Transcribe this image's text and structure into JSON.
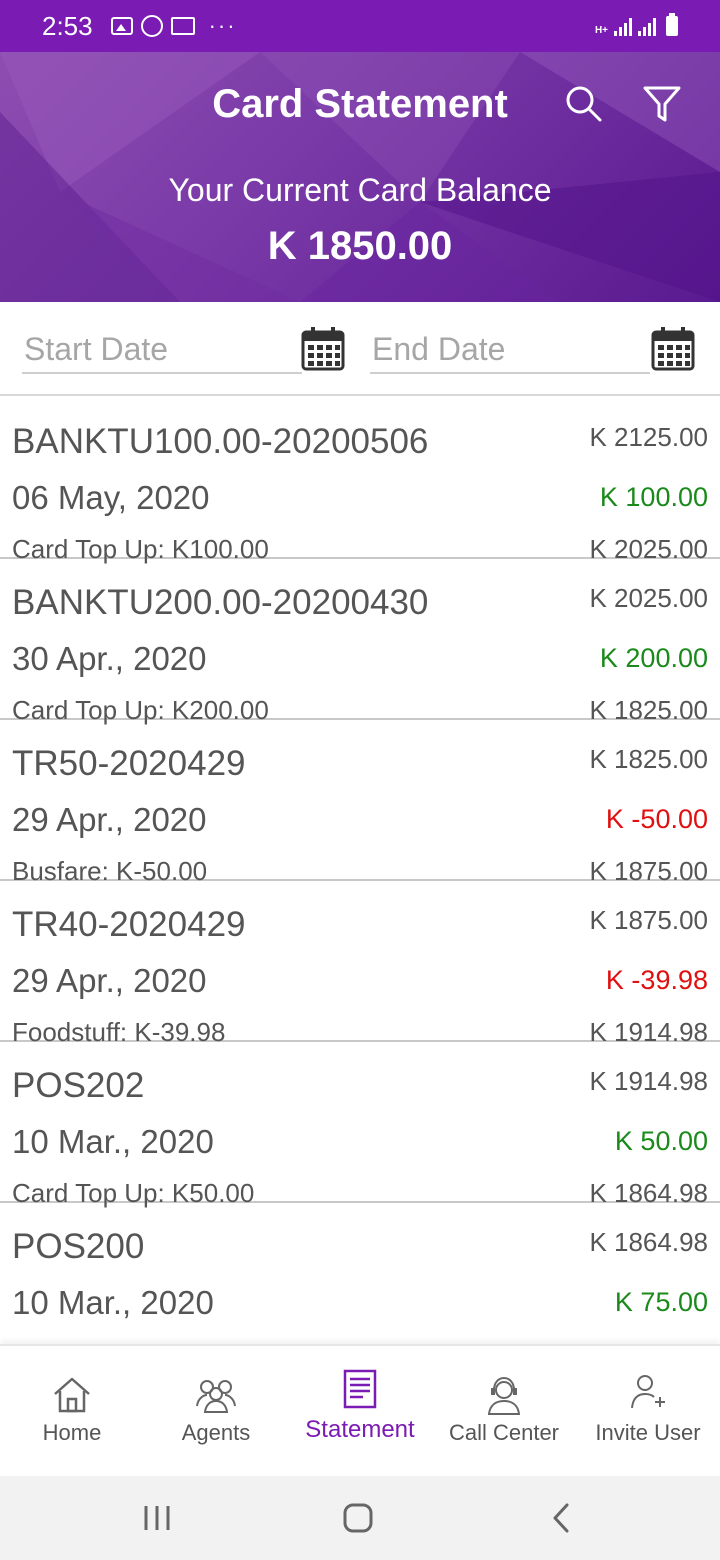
{
  "status_bar": {
    "time": "2:53",
    "more": "···",
    "network": "H+",
    "icons": [
      "gallery-icon",
      "whatsapp-icon",
      "mail-icon",
      "signal-icon",
      "battery-icon"
    ]
  },
  "header": {
    "title": "Card Statement",
    "balance_label": "Your Current Card Balance",
    "balance_value": "K 1850.00",
    "icons": [
      "search-icon",
      "filter-icon"
    ]
  },
  "date_filter": {
    "start_placeholder": "Start Date",
    "end_placeholder": "End Date"
  },
  "transactions": [
    {
      "ref": "BANKTU100.00-20200506",
      "date": "06 May, 2020",
      "desc": "Card Top Up: K100.00",
      "before": "K 2125.00",
      "amount": "K 100.00",
      "after": "K 2025.00",
      "type": "credit"
    },
    {
      "ref": "BANKTU200.00-20200430",
      "date": "30 Apr., 2020",
      "desc": "Card Top Up: K200.00",
      "before": "K 2025.00",
      "amount": "K 200.00",
      "after": "K 1825.00",
      "type": "credit"
    },
    {
      "ref": "TR50-2020429",
      "date": "29 Apr., 2020",
      "desc": "Busfare: K-50.00",
      "before": "K 1825.00",
      "amount": "K -50.00",
      "after": "K 1875.00",
      "type": "debit"
    },
    {
      "ref": "TR40-2020429",
      "date": "29 Apr., 2020",
      "desc": "Foodstuff: K-39.98",
      "before": "K 1875.00",
      "amount": "K -39.98",
      "after": "K 1914.98",
      "type": "debit"
    },
    {
      "ref": "POS202",
      "date": "10 Mar., 2020",
      "desc": "Card Top Up: K50.00",
      "before": "K 1914.98",
      "amount": "K 50.00",
      "after": "K 1864.98",
      "type": "credit"
    },
    {
      "ref": "POS200",
      "date": "10 Mar., 2020",
      "desc": "",
      "before": "K 1864.98",
      "amount": "K 75.00",
      "after": "",
      "type": "credit"
    }
  ],
  "bottom_nav": {
    "active": "Statement",
    "items": [
      {
        "label": "Home",
        "icon": "home-icon"
      },
      {
        "label": "Agents",
        "icon": "agents-icon"
      },
      {
        "label": "Statement",
        "icon": "statement-icon"
      },
      {
        "label": "Call Center",
        "icon": "call-center-icon"
      },
      {
        "label": "Invite User",
        "icon": "invite-user-icon"
      }
    ]
  },
  "colors": {
    "primary": "#7a1bb3",
    "credit": "#1a8a1a",
    "debit": "#e01010",
    "text": "#555555"
  }
}
